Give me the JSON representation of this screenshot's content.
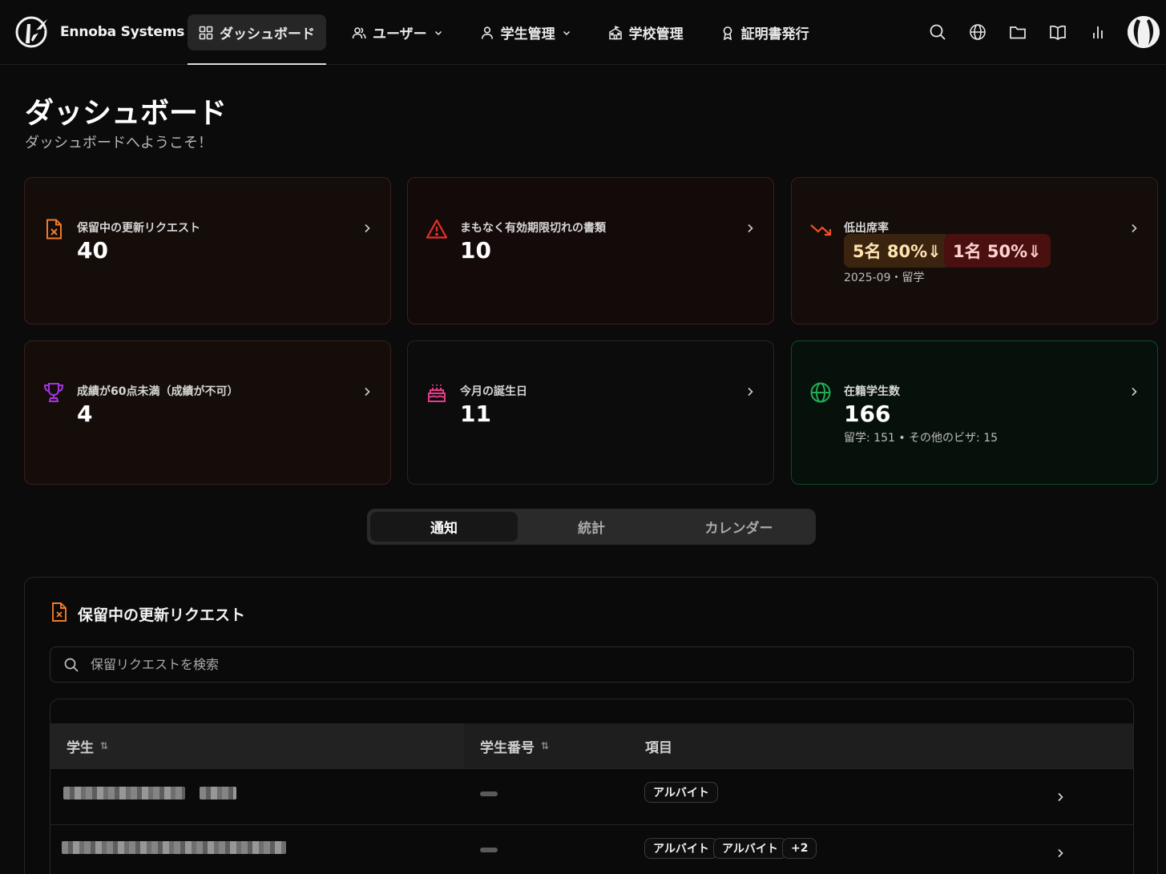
{
  "brand": {
    "name": "Ennoba Systems"
  },
  "nav": [
    {
      "label": "ダッシュボード",
      "icon": "grid-icon",
      "active": true
    },
    {
      "label": "ユーザー",
      "icon": "users-icon",
      "dropdown": true
    },
    {
      "label": "学生管理",
      "icon": "user-icon",
      "dropdown": true
    },
    {
      "label": "学校管理",
      "icon": "school-icon"
    },
    {
      "label": "証明書発行",
      "icon": "award-icon"
    }
  ],
  "tools": [
    "search-icon",
    "globe-icon",
    "folder-icon",
    "book-icon",
    "bar-chart-icon"
  ],
  "page": {
    "title": "ダッシュボード",
    "subtitle": "ダッシュボードへようこそ！"
  },
  "cards": {
    "pending": {
      "label": "保留中の更新リクエスト",
      "value": "40",
      "icon": "file-x-icon"
    },
    "expiring": {
      "label": "まもなく有効期限切れの書類",
      "value": "10",
      "icon": "alert-triangle-icon"
    },
    "attendance": {
      "label": "低出席率",
      "pill1": "5名 80%⇓",
      "pill2": "1名 50%⇓",
      "note": "2025-09・留学",
      "icon": "trending-down-icon"
    },
    "grades": {
      "label": "成績が60点未満（成績が不可）",
      "value": "4",
      "icon": "trophy-icon"
    },
    "birthdays": {
      "label": "今月の誕生日",
      "value": "11",
      "icon": "cake-icon"
    },
    "enrolled": {
      "label": "在籍学生数",
      "value": "166",
      "note": "留学: 151 • その他のビザ: 15",
      "icon": "globe-icon"
    }
  },
  "colors": {
    "orange": "#f07a2a",
    "red": "#e5302b",
    "purple": "#a633e8",
    "pink": "#e83c8c",
    "green": "#1fae52"
  },
  "tabs": [
    "通知",
    "統計",
    "カレンダー"
  ],
  "panel": {
    "title": "保留中の更新リクエスト",
    "search_placeholder": "保留リクエストを検索",
    "columns": {
      "student": "学生",
      "student_no": "学生番号",
      "items": "項目"
    },
    "sort_glyph": "⇅",
    "rows": [
      {
        "tags": [
          "アルバイト"
        ]
      },
      {
        "tags": [
          "アルバイト",
          "アルバイト",
          "+2"
        ]
      }
    ]
  }
}
